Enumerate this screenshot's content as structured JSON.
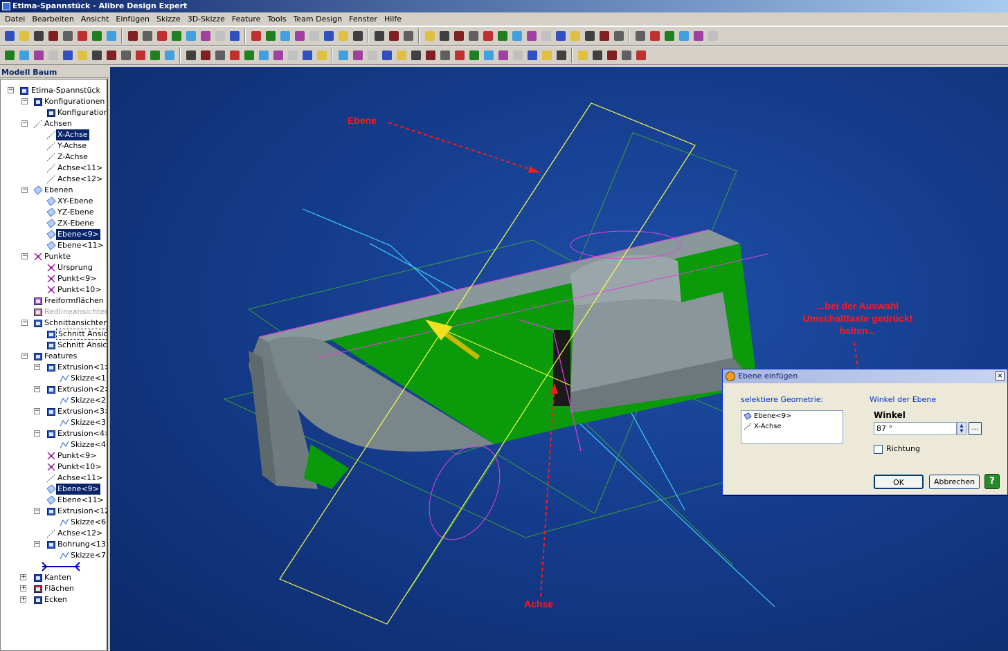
{
  "window": {
    "title": "Etima-Spannstück - Alibre Design Expert"
  },
  "menu": [
    "Datei",
    "Bearbeiten",
    "Ansicht",
    "Einfügen",
    "Skizze",
    "3D-Skizze",
    "Feature",
    "Tools",
    "Team Design",
    "Fenster",
    "Hilfe"
  ],
  "tree": {
    "title": "Modell Baum",
    "rows": [
      {
        "label": "Etima-Spannstück",
        "icon": "part-icon"
      },
      {
        "label": "Konfigurationen",
        "icon": "table-icon"
      },
      {
        "label": "Konfiguration<1>",
        "icon": "table-icon"
      },
      {
        "label": "Achsen",
        "icon": "axis-icon"
      },
      {
        "label": "X-Achse",
        "icon": "axis-icon"
      },
      {
        "label": "Y-Achse",
        "icon": "axis-icon"
      },
      {
        "label": "Z-Achse",
        "icon": "axis-icon"
      },
      {
        "label": "Achse<11>",
        "icon": "axis-icon"
      },
      {
        "label": "Achse<12>",
        "icon": "axis-icon"
      },
      {
        "label": "Ebenen",
        "icon": "plane-icon"
      },
      {
        "label": "XY-Ebene",
        "icon": "plane-icon"
      },
      {
        "label": "YZ-Ebene",
        "icon": "plane-icon"
      },
      {
        "label": "ZX-Ebene",
        "icon": "plane-icon"
      },
      {
        "label": "Ebene<9>",
        "icon": "plane-icon"
      },
      {
        "label": "Ebene<11>",
        "icon": "plane-icon"
      },
      {
        "label": "Punkte",
        "icon": "point-icon"
      },
      {
        "label": "Ursprung",
        "icon": "point-icon"
      },
      {
        "label": "Punkt<9>",
        "icon": "point-icon"
      },
      {
        "label": "Punkt<10>",
        "icon": "point-icon"
      },
      {
        "label": "Freiformflächen",
        "icon": "freeform-icon"
      },
      {
        "label": "Redlineansichten",
        "icon": "redline-icon"
      },
      {
        "label": "Schnittansichten",
        "icon": "section-icon"
      },
      {
        "label": "Schnitt Ansicht",
        "icon": "section-icon"
      },
      {
        "label": "Schnitt Ansicht",
        "icon": "section-icon"
      },
      {
        "label": "Features",
        "icon": "features-icon"
      },
      {
        "label": "Extrusion<1>",
        "icon": "extrude-icon"
      },
      {
        "label": "Skizze<1>",
        "icon": "sketch-icon"
      },
      {
        "label": "Extrusion<2>",
        "icon": "extrude-icon"
      },
      {
        "label": "Skizze<2>",
        "icon": "sketch-icon"
      },
      {
        "label": "Extrusion<3>",
        "icon": "extrude-icon"
      },
      {
        "label": "Skizze<3>",
        "icon": "sketch-icon"
      },
      {
        "label": "Extrusion<4>",
        "icon": "extrude-icon"
      },
      {
        "label": "Skizze<4>",
        "icon": "sketch-icon"
      },
      {
        "label": "Punkt<9>",
        "icon": "point-icon"
      },
      {
        "label": "Punkt<10>",
        "icon": "point-icon"
      },
      {
        "label": "Achse<11>",
        "icon": "axis-icon"
      },
      {
        "label": "Ebene<9>",
        "icon": "plane-icon"
      },
      {
        "label": "Ebene<11>",
        "icon": "plane-icon"
      },
      {
        "label": "Extrusion<12>",
        "icon": "extrude-icon"
      },
      {
        "label": "Skizze<6>",
        "icon": "sketch-icon"
      },
      {
        "label": "Achse<12>",
        "icon": "axis-icon"
      },
      {
        "label": "Bohrung<13>",
        "icon": "hole-icon"
      },
      {
        "label": "Skizze<7>",
        "icon": "sketch-icon"
      },
      {
        "label": "",
        "icon": "rollback-marker-icon"
      },
      {
        "label": "Kanten",
        "icon": "edges-icon"
      },
      {
        "label": "Flächen",
        "icon": "faces-icon"
      },
      {
        "label": "Ecken",
        "icon": "vertices-icon"
      }
    ]
  },
  "annotations": {
    "ebene": "Ebene",
    "achse": "Achse",
    "hint_line1": "...bei der Auswahl",
    "hint_line2": "Umschalttaste gedrückt",
    "hint_line3": "halten..."
  },
  "dialog": {
    "title": "Ebene einfügen",
    "close": "×",
    "geometry_label": "selektiere Geometrie:",
    "geometry_items": [
      "Ebene<9>",
      "X-Achse"
    ],
    "angle_section_label": "Winkel der Ebene",
    "angle_title": "Winkel",
    "angle_value": "87 °",
    "more_button": "...",
    "direction_label": "Richtung",
    "ok": "OK",
    "cancel": "Abbrechen",
    "help": "?"
  },
  "colors": {
    "viewport_bg": "#153c8c",
    "part_gray": "#7d8a8e",
    "part_green": "#0a9a0a",
    "plane_yellow": "#ffff40",
    "plane_green": "#3aa03a",
    "axis_cyan": "#40d0ff",
    "sketch_magenta": "#e040e0",
    "annotation_red": "#ff1a1a"
  }
}
